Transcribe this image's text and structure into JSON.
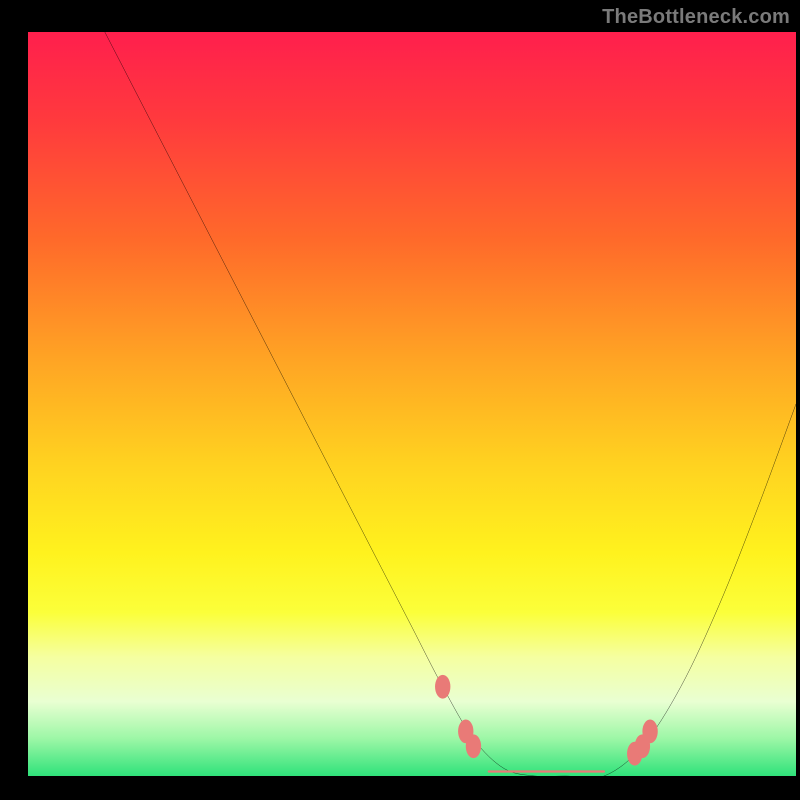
{
  "watermark": {
    "text": "TheBottleneck.com"
  },
  "chart_data": {
    "type": "line",
    "title": "",
    "xlabel": "",
    "ylabel": "",
    "xlim": [
      0,
      100
    ],
    "ylim": [
      0,
      100
    ],
    "series": [
      {
        "name": "curve",
        "x": [
          10,
          14,
          18,
          22,
          26,
          30,
          34,
          38,
          42,
          46,
          50,
          54,
          58,
          62,
          66,
          70,
          75,
          80,
          85,
          90,
          95,
          100
        ],
        "y": [
          100,
          92,
          84,
          76,
          68,
          60,
          52,
          44,
          36,
          28,
          20,
          12,
          5,
          1,
          0,
          0,
          0,
          4,
          12,
          23,
          36,
          50
        ]
      }
    ],
    "highlights": {
      "name": "coral-dots",
      "points": [
        {
          "x": 54,
          "y": 12
        },
        {
          "x": 57,
          "y": 6
        },
        {
          "x": 58,
          "y": 4
        },
        {
          "x": 79,
          "y": 3
        },
        {
          "x": 80,
          "y": 4
        },
        {
          "x": 81,
          "y": 6
        }
      ],
      "plateau": {
        "x0": 60,
        "x1": 75,
        "y": 0
      }
    },
    "gradient_stops": [
      {
        "pos": 0,
        "color": "#ff1f4d"
      },
      {
        "pos": 12,
        "color": "#ff3a3d"
      },
      {
        "pos": 28,
        "color": "#ff6a2a"
      },
      {
        "pos": 44,
        "color": "#ffa424"
      },
      {
        "pos": 58,
        "color": "#ffd220"
      },
      {
        "pos": 70,
        "color": "#fff21e"
      },
      {
        "pos": 78,
        "color": "#fbff3a"
      },
      {
        "pos": 84,
        "color": "#f5ffa0"
      },
      {
        "pos": 90,
        "color": "#e9ffd2"
      },
      {
        "pos": 95,
        "color": "#9cf7a6"
      },
      {
        "pos": 100,
        "color": "#2fe27a"
      }
    ],
    "colors": {
      "curve": "#000000",
      "highlight": "#e97a77",
      "frame": "#000000"
    }
  }
}
